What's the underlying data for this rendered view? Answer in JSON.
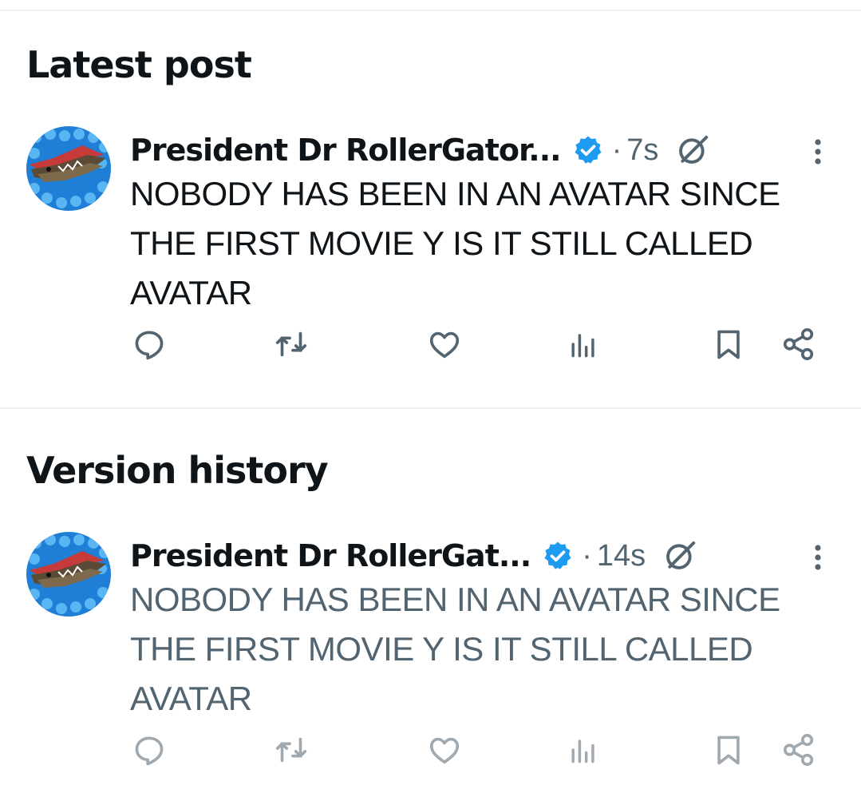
{
  "latest": {
    "heading": "Latest post",
    "author": "President Dr RollerGator...",
    "time": "7s",
    "separator": "·",
    "text": "NOBODY HAS BEEN IN AN AVATAR SINCE THE FIRST MOVIE Y IS IT STILL CALLED AVATAR"
  },
  "history": {
    "heading": "Version history",
    "author": "President Dr RollerGat...",
    "time": "14s",
    "separator": "·",
    "text": "NOBODY HAS BEEN IN AN AVATAR SINCE THE FIRST MOVIE Y IS IT STILL CALLED AVATAR"
  },
  "icons": {
    "reply": "reply-icon",
    "repost": "repost-icon",
    "like": "like-icon",
    "views": "views-icon",
    "bookmark": "bookmark-icon",
    "share": "share-icon",
    "verified": "verified-badge-icon",
    "grok": "grok-icon",
    "more": "more-options-icon"
  },
  "colors": {
    "verified": "#1d9bf0",
    "text_primary": "#0f1419",
    "text_secondary": "#536471",
    "divider": "#eff3f4"
  }
}
